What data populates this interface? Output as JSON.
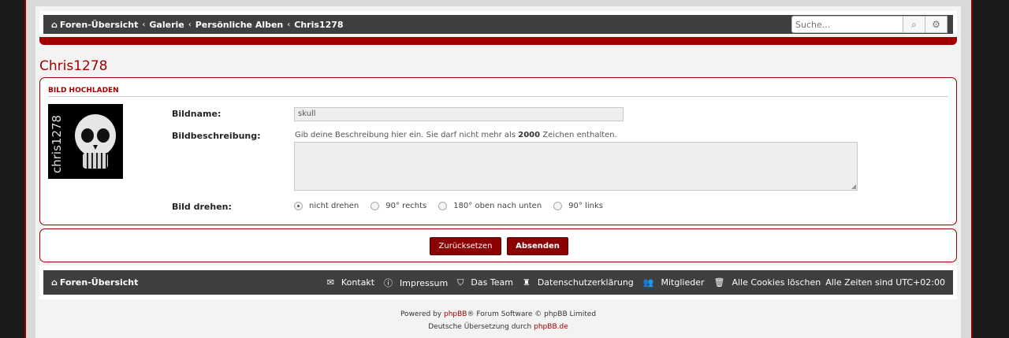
{
  "breadcrumbs": [
    "Foren-Übersicht",
    "Galerie",
    "Persönliche Alben",
    "Chris1278"
  ],
  "search": {
    "placeholder": "Suche..."
  },
  "page_title": "Chris1278",
  "upload": {
    "heading": "BILD HOCHLADEN",
    "avatar_text": "chris1278",
    "name_label": "Bildname:",
    "name_value": "skull",
    "desc_label": "Bildbeschreibung:",
    "desc_hint_before": "Gib deine Beschreibung hier ein. Sie darf nicht mehr als",
    "desc_hint_number": "2000",
    "desc_hint_after": "Zeichen enthalten.",
    "rotate_label": "Bild drehen:",
    "rotate_options": [
      "nicht drehen",
      "90° rechts",
      "180° oben nach unten",
      "90° links"
    ],
    "rotate_selected": "nicht drehen"
  },
  "buttons": {
    "reset": "Zurücksetzen",
    "submit": "Absenden"
  },
  "footer": {
    "home": "Foren-Übersicht",
    "links": [
      "Kontakt",
      "Impressum",
      "Das Team",
      "Datenschutzerklärung",
      "Mitglieder",
      "Alle Cookies löschen"
    ],
    "timezone": "Alle Zeiten sind UTC+02:00"
  },
  "copyright": {
    "line1_before": "Powered by",
    "line1_link": "phpBB",
    "line1_after": "® Forum Software © phpBB Limited",
    "line2_before": "Deutsche Übersetzung durch",
    "line2_link": "phpBB.de"
  },
  "colors": {
    "accent": "#a00000",
    "bar": "#3f3f3f"
  },
  "icons": [
    "home-icon",
    "search-icon",
    "gear-icon",
    "envelope-icon",
    "info-icon",
    "shield-icon",
    "user-icon",
    "users-icon",
    "trash-icon"
  ]
}
